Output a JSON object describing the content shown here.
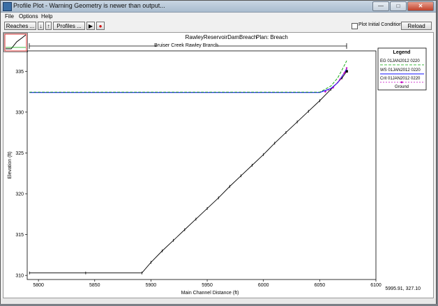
{
  "window": {
    "title": "Profile Plot - Warning Geometry is newer than output..."
  },
  "menu": {
    "file": "File",
    "options": "Options",
    "help": "Help"
  },
  "toolbar": {
    "reaches_label": "Reaches ...",
    "profiles_label": "Profiles ...",
    "plot_initial_label": "Plot Initial Conditions",
    "reload_label": "Reload Data"
  },
  "plot": {
    "title": "RawleyReservoirDamBreach",
    "plan": "Plan: Breach",
    "reach": "Bruiser Creek Rawley Branch",
    "xlabel": "Main Channel Distance (ft)",
    "ylabel": "Elevation (ft)",
    "coordinates": "5995.91, 327.10"
  },
  "legend": {
    "title": "Legend",
    "items": [
      "EG  01JAN2012 0220",
      "WS  01JAN2012 0220",
      "Crit  01JAN2012 0220",
      "Ground"
    ]
  },
  "colors": {
    "eg": "#00a000",
    "ws": "#1010ff",
    "crit": "#c000c0",
    "ground": "#000000"
  },
  "chart_data": {
    "type": "line",
    "xlim": [
      5790,
      6100
    ],
    "ylim": [
      309.5,
      337.5
    ],
    "xticks": [
      5800,
      5850,
      5900,
      5950,
      6000,
      6050,
      6100
    ],
    "yticks": [
      310,
      315,
      320,
      325,
      330,
      335
    ],
    "series": [
      {
        "name": "Ground",
        "x": [
          5792,
          5842,
          5892,
          5900,
          5910,
          5920,
          5930,
          5940,
          5950,
          5960,
          5970,
          5980,
          5990,
          6000,
          6010,
          6020,
          6030,
          6040,
          6050,
          6060,
          6070,
          6074
        ],
        "y": [
          310.3,
          310.3,
          310.3,
          311.6,
          313.0,
          314.3,
          315.6,
          316.9,
          318.2,
          319.5,
          320.9,
          322.2,
          323.5,
          324.8,
          326.2,
          327.5,
          328.8,
          330.1,
          331.4,
          332.8,
          334.2,
          335.0
        ]
      },
      {
        "name": "WS 01JAN2012 0220",
        "x": [
          5792,
          6050,
          6060,
          6066,
          6070,
          6074
        ],
        "y": [
          332.4,
          332.4,
          332.9,
          333.6,
          334.4,
          335.3
        ]
      },
      {
        "name": "EG 01JAN2012 0220",
        "x": [
          5792,
          6050,
          6060,
          6066,
          6070,
          6074
        ],
        "y": [
          332.45,
          332.45,
          333.2,
          334.2,
          335.2,
          336.3
        ]
      },
      {
        "name": "Crit 01JAN2012 0220",
        "x": [
          6055,
          6062,
          6068,
          6072,
          6074
        ],
        "y": [
          332.5,
          333.0,
          334.0,
          334.8,
          335.4
        ]
      }
    ]
  }
}
